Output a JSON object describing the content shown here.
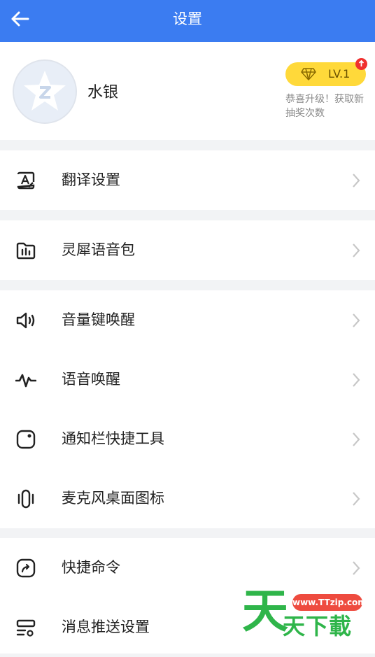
{
  "header": {
    "title": "设置",
    "back_icon": "back-arrow-icon"
  },
  "profile": {
    "username": "水银",
    "level": "LV.1",
    "promo": "恭喜升级！获取新抽奖次数",
    "avatar_icon": "default-avatar-star-icon"
  },
  "sections": [
    {
      "items": [
        {
          "label": "翻译设置",
          "icon": "translate-icon"
        }
      ]
    },
    {
      "items": [
        {
          "label": "灵犀语音包",
          "icon": "voice-pack-folder-icon"
        }
      ]
    },
    {
      "items": [
        {
          "label": "音量键唤醒",
          "icon": "volume-icon"
        },
        {
          "label": "语音唤醒",
          "icon": "waveform-icon"
        },
        {
          "label": "通知栏快捷工具",
          "icon": "notification-tool-icon"
        },
        {
          "label": "麦克风桌面图标",
          "icon": "microphone-icon"
        }
      ]
    },
    {
      "items": [
        {
          "label": "快捷命令",
          "icon": "shortcut-icon"
        },
        {
          "label": "消息推送设置",
          "icon": "message-push-icon"
        }
      ]
    }
  ],
  "watermark": {
    "url": "www.TTzip.com",
    "big": "天",
    "text": "天下載"
  },
  "colors": {
    "header": "#3b7cf1",
    "badge": "#ffd93a",
    "watermark": "#2fb54a"
  }
}
